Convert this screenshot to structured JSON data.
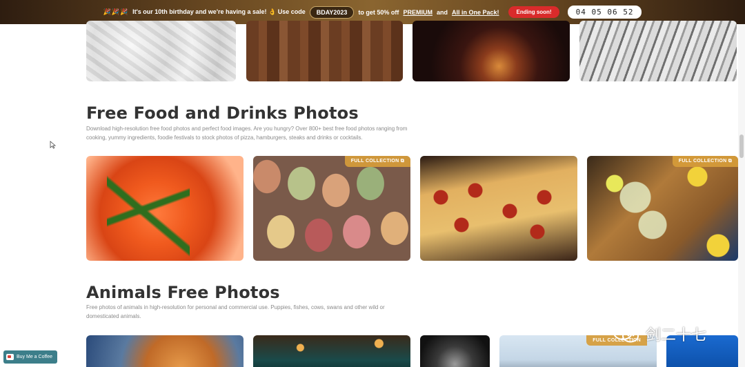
{
  "promo": {
    "party": "🎉🎉🎉",
    "text_before": "It's our 10th birthday and we're having a sale! 👌 Use code",
    "code": "BDAY2023",
    "text_mid": "to get 50% off",
    "premium": "PREMIUM",
    "and": "and",
    "pack": "All in One Pack!",
    "ending": "Ending soon!",
    "timer": "04 05 06 52"
  },
  "food": {
    "title": "Free Food and Drinks Photos",
    "description_line1": "Download high-resolution free food photos and perfect food images. Are you hungry? Over 800+ best free food photos ranging from",
    "description_line2": "cooking, yummy ingredients, foodie festivals to stock photos of pizza, hamburgers, steaks and drinks or cocktails.",
    "badge": "FULL COLLECTION ⧉"
  },
  "animals": {
    "title": "Animals Free Photos",
    "description_line1": "Free photos of animals in high-resolution for personal and commercial use. Puppies, fishes, cows, swans and other wild or",
    "description_line2": "domesticated animals.",
    "badge": "FULL COLLECTION"
  },
  "buy_me_a_coffee": "Buy Me a Coffee",
  "watermark": "剑二十七",
  "colors": {
    "accent_badge": "#d69c3a",
    "ending_red": "#d92b2b",
    "heading": "#333333",
    "body_text": "#8a8a8a",
    "bmc_teal": "#3c7e8a"
  }
}
